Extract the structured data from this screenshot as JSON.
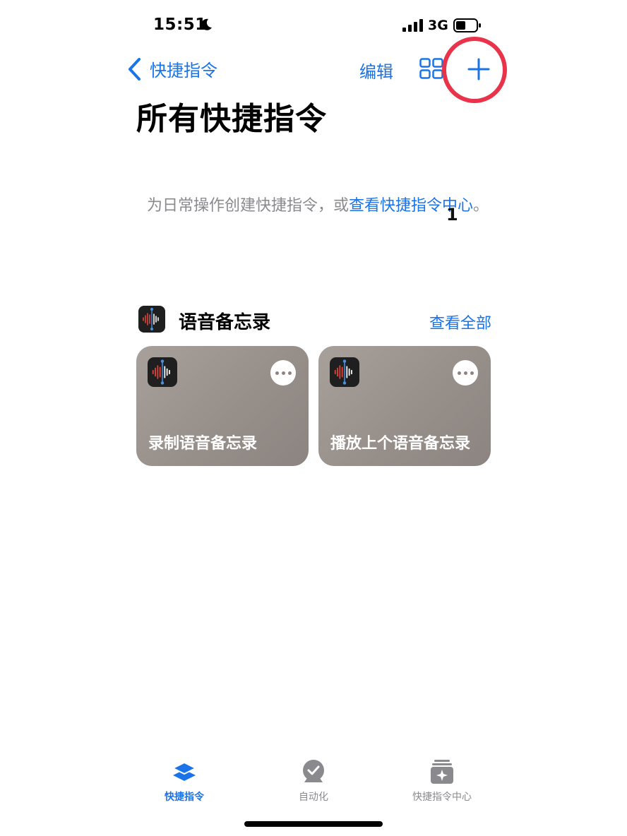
{
  "status_bar": {
    "time": "15:51",
    "network": "3G",
    "icons": [
      "moon-icon",
      "signal-icon",
      "battery-icon"
    ]
  },
  "nav": {
    "back_label": "快捷指令",
    "edit_label": "编辑",
    "icons": [
      "chevron-left-icon",
      "grid-icon",
      "plus-icon"
    ]
  },
  "page": {
    "title": "所有快捷指令",
    "intro_text": "为日常操作创建快捷指令，或",
    "intro_link": "查看快捷指令中心",
    "intro_end": "。",
    "annotation": "1"
  },
  "section": {
    "title": "语音备忘录",
    "see_all": "查看全部",
    "cards": [
      {
        "title": "录制语音备忘录"
      },
      {
        "title": "播放上个语音备忘录"
      }
    ]
  },
  "tabbar": {
    "tabs": [
      {
        "label": "快捷指令",
        "icon": "layers-icon",
        "selected": true
      },
      {
        "label": "自动化",
        "icon": "clock-check-icon",
        "selected": false
      },
      {
        "label": "快捷指令中心",
        "icon": "gallery-sparkle-icon",
        "selected": false
      }
    ]
  },
  "colors": {
    "accent": "#1a73e8",
    "highlight": "#e8334a",
    "card": "#9a928d",
    "wave_red": "#e0443c",
    "wave_white": "#ffffff"
  }
}
